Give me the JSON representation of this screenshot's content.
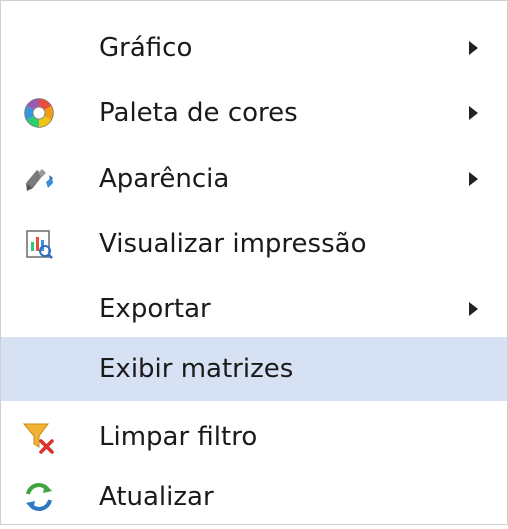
{
  "menu": {
    "items": [
      {
        "label": "Gráfico",
        "icon": null,
        "submenu": true
      },
      {
        "label": "Paleta de cores",
        "icon": "color-palette-icon",
        "submenu": true
      },
      {
        "label": "Aparência",
        "icon": "appearance-brush-icon",
        "submenu": true
      },
      {
        "label": "Visualizar impressão",
        "icon": "print-preview-icon",
        "submenu": false
      },
      {
        "label": "Exportar",
        "icon": null,
        "submenu": true
      },
      {
        "label": "Exibir matrizes",
        "icon": null,
        "submenu": false,
        "highlighted": true
      },
      {
        "label": "Limpar filtro",
        "icon": "clear-filter-icon",
        "submenu": false
      },
      {
        "label": "Atualizar",
        "icon": "refresh-icon",
        "submenu": false
      }
    ]
  },
  "colors": {
    "highlight": "#d6e2f3",
    "text": "#1a1a1a",
    "border": "#cfcfcf"
  }
}
